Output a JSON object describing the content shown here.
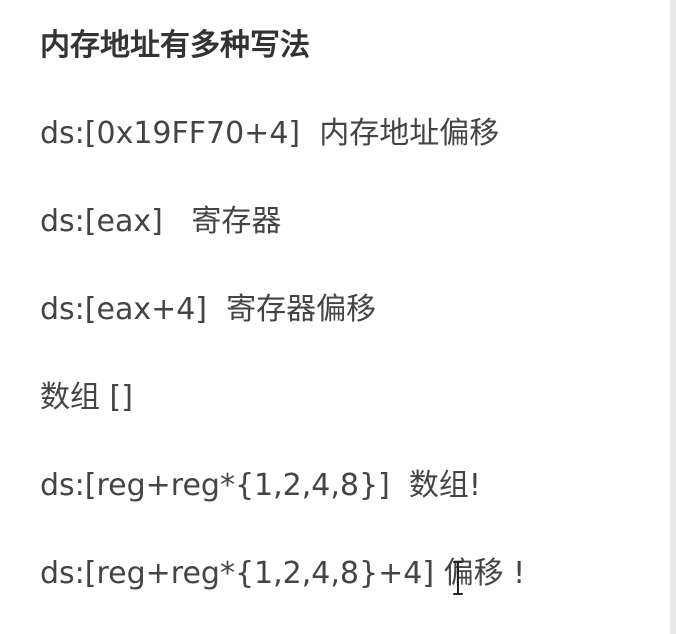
{
  "title": "内存地址有多种写法",
  "lines": [
    {
      "code": "ds:[0x19FF70+4]",
      "sep": "  ",
      "note": "内存地址偏移"
    },
    {
      "code": "ds:[eax]",
      "sep": "   ",
      "note": "寄存器"
    },
    {
      "code": "ds:[eax+4]",
      "sep": "  ",
      "note": "寄存器偏移"
    },
    {
      "code": "数组 []",
      "sep": "",
      "note": ""
    },
    {
      "code": "ds:[reg+reg*{1,2,4,8}]",
      "sep": "  ",
      "note": "数组!"
    },
    {
      "code": "ds:[reg+reg*{1,2,4,8}+4]",
      "sep": " ",
      "note": "偏移 !"
    }
  ]
}
